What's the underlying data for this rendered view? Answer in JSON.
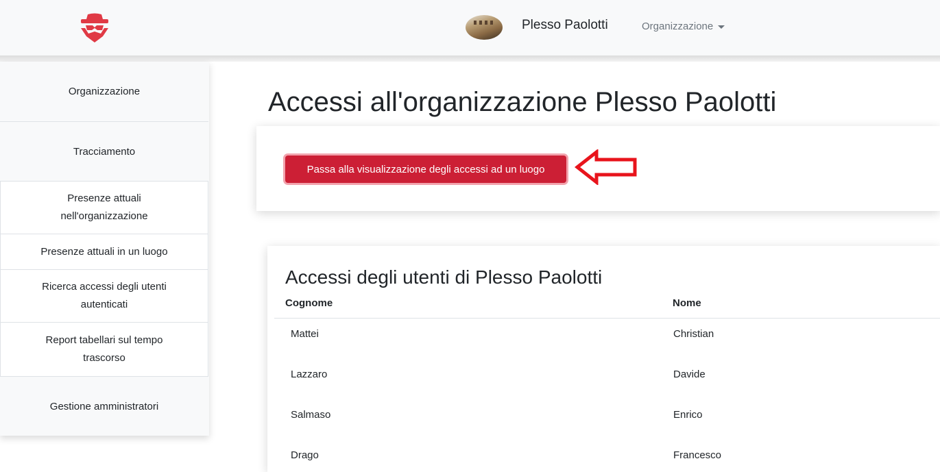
{
  "navbar": {
    "logo_icon": "spy-hat-logo-icon",
    "org_name": "Plesso Paolotti",
    "dropdown_label": "Organizzazione",
    "brand_color": "#e03a45"
  },
  "sidebar": {
    "items": [
      {
        "label": "Organizzazione"
      },
      {
        "label": "Tracciamento"
      },
      {
        "label": "Gestione amministratori"
      }
    ],
    "subitems": [
      {
        "label": "Presenze attuali nell'organizzazione"
      },
      {
        "label": "Presenze attuali in un luogo"
      },
      {
        "label": "Ricerca accessi degli utenti autenticati"
      },
      {
        "label": "Report tabellari sul tempo trascorso"
      }
    ]
  },
  "main": {
    "title": "Accessi all'organizzazione Plesso Paolotti",
    "switch_button": "Passa alla visualizzazione degli accessi ad un luogo",
    "annotation_icon": "red-arrow-left-icon",
    "table": {
      "title": "Accessi degli utenti di Plesso Paolotti",
      "columns": [
        "Cognome",
        "Nome"
      ],
      "rows": [
        [
          "Mattei",
          "Christian"
        ],
        [
          "Lazzaro",
          "Davide"
        ],
        [
          "Salmaso",
          "Enrico"
        ],
        [
          "Drago",
          "Francesco"
        ]
      ]
    }
  },
  "colors": {
    "primary_button": "#cc1f35",
    "annotation_arrow": "#e8141c",
    "sidebar_bg": "#f8f9fa"
  }
}
